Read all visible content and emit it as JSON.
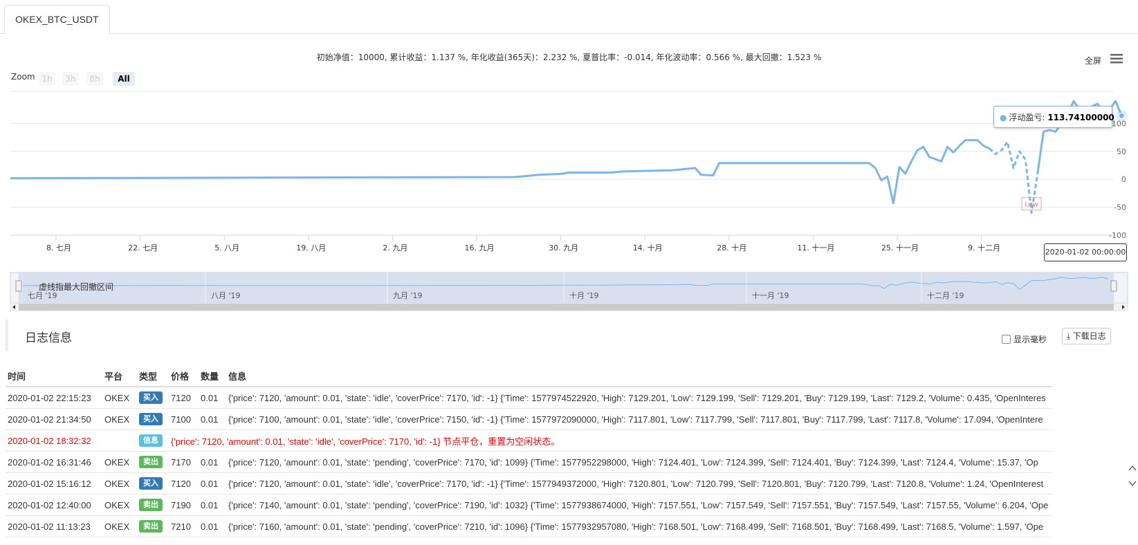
{
  "tab": {
    "label": "OKEX_BTC_USDT"
  },
  "summary": "初始净值：10000, 累计收益：1.137 %, 年化收益(365天)：2.232 %, 夏普比率：-0.014, 年化波动率：0.566 %, 最大回撤：1.523 %",
  "toolbar": {
    "fullscreen_label": "全屏",
    "menu_icon": "hamburger-icon"
  },
  "zoom": {
    "label": "Zoom",
    "buttons": [
      "1h",
      "3h",
      "8h",
      "All"
    ],
    "active": "All"
  },
  "colors": {
    "series": "#7cb5ec",
    "buy": "#337ab7",
    "sell": "#5cb85c",
    "info": "#5bc0de",
    "error": "#ee0000"
  },
  "chart_data": {
    "type": "line",
    "title": "",
    "x_labels": [
      "8. 七月",
      "22. 七月",
      "5. 八月",
      "19. 八月",
      "2. 九月",
      "16. 九月",
      "30. 九月",
      "14. 十月",
      "28. 十月",
      "11. 十一月",
      "25. 十一月",
      "9. 十二月"
    ],
    "y_ticks": [
      "100",
      "50",
      "0",
      "-50",
      "-100"
    ],
    "ylim": [
      -100,
      150
    ],
    "xlim": [
      "2019-07-01",
      "2020-01-03"
    ],
    "series": [
      {
        "name": "浮动盈亏",
        "x": [
          "2019-07-01",
          "2019-09-23",
          "2019-09-25",
          "2019-09-27",
          "2019-10-01",
          "2019-10-02",
          "2019-10-09",
          "2019-10-11",
          "2019-10-19",
          "2019-10-21",
          "2019-10-23",
          "2019-10-24",
          "2019-10-26",
          "2019-10-27",
          "2019-11-21",
          "2019-11-22",
          "2019-11-23",
          "2019-11-24",
          "2019-11-25",
          "2019-11-26",
          "2019-11-27",
          "2019-11-28",
          "2019-11-29",
          "2019-11-30",
          "2019-12-01",
          "2019-12-02",
          "2019-12-03",
          "2019-12-04",
          "2019-12-05",
          "2019-12-06",
          "2019-12-07",
          "2019-12-08",
          "2019-12-09",
          "2019-12-10",
          "2019-12-11"
        ],
        "y": [
          2,
          4,
          6,
          8,
          10,
          12,
          12,
          14,
          16,
          18,
          20,
          8,
          7,
          29,
          29,
          20,
          -2,
          5,
          -43,
          22,
          10,
          32,
          52,
          58,
          40,
          36,
          32,
          58,
          48,
          60,
          70,
          70,
          70,
          60,
          55
        ]
      },
      {
        "name": "虚线指最大回撤区间",
        "dashed": true,
        "x": [
          "2019-12-11",
          "2019-12-12",
          "2019-12-13",
          "2019-12-14",
          "2019-12-15",
          "2019-12-16",
          "2019-12-17",
          "2019-12-18",
          "2019-12-19"
        ],
        "y": [
          55,
          45,
          52,
          67,
          20,
          50,
          35,
          -60,
          10
        ]
      },
      {
        "name": "浮动盈亏",
        "x": [
          "2019-12-19",
          "2019-12-20",
          "2019-12-21",
          "2019-12-22",
          "2019-12-23",
          "2019-12-24",
          "2019-12-25",
          "2019-12-26",
          "2019-12-27",
          "2019-12-28",
          "2019-12-29",
          "2019-12-30",
          "2019-12-31",
          "2020-01-01",
          "2020-01-02"
        ],
        "y": [
          10,
          85,
          88,
          85,
          100,
          115,
          140,
          125,
          120,
          130,
          135,
          120,
          125,
          140,
          113.741
        ]
      }
    ],
    "low_label": "Low",
    "tooltip": {
      "series": "浮动盈亏",
      "value": "113.74100000",
      "date": "2020-01-02 00:00:00"
    },
    "navigator": {
      "labels": [
        "七月 '19",
        "八月 '19",
        "九月 '19",
        "十月 '19",
        "十一月 '19",
        "十二月 '19"
      ],
      "legend": "虚线指最大回撤区间"
    }
  },
  "log": {
    "title": "日志信息",
    "show_ms_label": "显示毫秒",
    "download_label": "下载日志",
    "columns": [
      "时间",
      "平台",
      "类型",
      "价格",
      "数量",
      "信息"
    ],
    "rows": [
      {
        "time": "2020-01-02 22:15:23",
        "platform": "OKEX",
        "type": "买入",
        "kind": "buy",
        "price": "7120",
        "amount": "0.01",
        "info": "{'price': 7120, 'amount': 0.01, 'state': 'idle', 'coverPrice': 7170, 'id': -1} {'Time': 1577974522920, 'High': 7129.201, 'Low': 7129.199, 'Sell': 7129.201, 'Buy': 7129.199, 'Last': 7129.2, 'Volume': 0.435, 'OpenInteres"
      },
      {
        "time": "2020-01-02 21:34:50",
        "platform": "OKEX",
        "type": "买入",
        "kind": "buy",
        "price": "7100",
        "amount": "0.01",
        "info": "{'price': 7100, 'amount': 0.01, 'state': 'idle', 'coverPrice': 7150, 'id': -1} {'Time': 1577972090000, 'High': 7117.801, 'Low': 7117.799, 'Sell': 7117.801, 'Buy': 7117.799, 'Last': 7117.8, 'Volume': 17.094, 'OpenIntere"
      },
      {
        "time": "2020-01-02 18:32:32",
        "platform": "",
        "type": "信息",
        "kind": "info",
        "price": "",
        "amount": "",
        "info": "{'price': 7120, 'amount': 0.01, 'state': 'idle', 'coverPrice': 7170, 'id': -1} 节点平仓，重置为空闲状态。"
      },
      {
        "time": "2020-01-02 16:31:46",
        "platform": "OKEX",
        "type": "卖出",
        "kind": "sell",
        "price": "7170",
        "amount": "0.01",
        "info": "{'price': 7120, 'amount': 0.01, 'state': 'pending', 'coverPrice': 7170, 'id': 1099} {'Time': 1577952298000, 'High': 7124.401, 'Low': 7124.399, 'Sell': 7124.401, 'Buy': 7124.399, 'Last': 7124.4, 'Volume': 15.37, 'Op"
      },
      {
        "time": "2020-01-02 15:16:12",
        "platform": "OKEX",
        "type": "买入",
        "kind": "buy",
        "price": "7120",
        "amount": "0.01",
        "info": "{'price': 7120, 'amount': 0.01, 'state': 'idle', 'coverPrice': 7170, 'id': -1} {'Time': 1577949372000, 'High': 7120.801, 'Low': 7120.799, 'Sell': 7120.801, 'Buy': 7120.799, 'Last': 7120.8, 'Volume': 1.24, 'OpenInterest"
      },
      {
        "time": "2020-01-02 12:40:00",
        "platform": "OKEX",
        "type": "卖出",
        "kind": "sell",
        "price": "7190",
        "amount": "0.01",
        "info": "{'price': 7140, 'amount': 0.01, 'state': 'pending', 'coverPrice': 7190, 'id': 1032} {'Time': 1577938674000, 'High': 7157.551, 'Low': 7157.549, 'Sell': 7157.551, 'Buy': 7157.549, 'Last': 7157.55, 'Volume': 6.204, 'Ope"
      },
      {
        "time": "2020-01-02 11:13:23",
        "platform": "OKEX",
        "type": "卖出",
        "kind": "sell",
        "price": "7210",
        "amount": "0.01",
        "info": "{'price': 7160, 'amount': 0.01, 'state': 'pending', 'coverPrice': 7210, 'id': 1096} {'Time': 1577932957080, 'High': 7168.501, 'Low': 7168.499, 'Sell': 7168.501, 'Buy': 7168.499, 'Last': 7168.5, 'Volume': 1.597, 'Ope"
      }
    ]
  }
}
